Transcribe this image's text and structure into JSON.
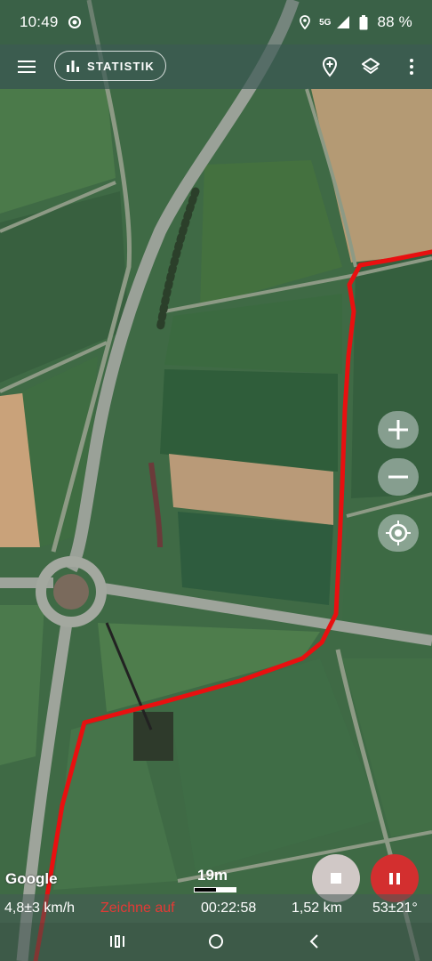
{
  "status_bar": {
    "time": "10:49",
    "network": "5G",
    "battery": "88 %",
    "icons": [
      "record-icon",
      "location-icon",
      "signal-icon",
      "battery-icon"
    ]
  },
  "app_bar": {
    "menu_icon": "menu-icon",
    "stats_button_label": "STATISTIK",
    "stats_icon": "bar-chart-icon",
    "add_marker_icon": "add-location-icon",
    "layers_icon": "layers-icon",
    "more_icon": "more-vert-icon"
  },
  "map": {
    "attribution": "Google",
    "scale_label": "19m",
    "colors": {
      "track": "#e81010",
      "pause_button": "#d32f2f",
      "recording_text": "#e53935"
    }
  },
  "controls": {
    "zoom_in_icon": "plus-icon",
    "zoom_out_icon": "minus-icon",
    "locate_icon": "my-location-icon",
    "stop_icon": "stop-icon",
    "pause_icon": "pause-icon"
  },
  "stats": {
    "speed": "4,8±3 km/h",
    "recording_status": "Zeichne auf",
    "duration": "00:22:58",
    "distance": "1,52 km",
    "heading": "53±21°"
  },
  "nav_bar": {
    "icons": [
      "recents-icon",
      "home-icon",
      "back-icon"
    ]
  }
}
